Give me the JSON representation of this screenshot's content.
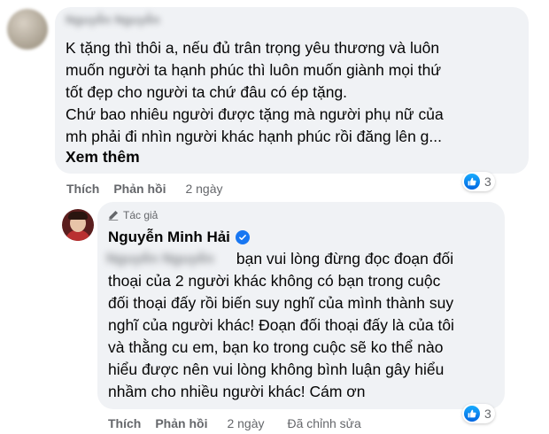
{
  "comment": {
    "author_blurred": "Nguyễn Nguyễn",
    "lines": [
      "K tặng thì thôi a, nếu đủ trân trọng yêu thương và luôn",
      "muốn người ta hạnh phúc thì luôn muốn giành mọi thứ",
      "tốt đẹp cho người ta chứ đâu có ép tặng.",
      "Chứ bao nhiêu người được tặng mà người phụ nữ của",
      "mh phải đi nhìn người khác hạnh phúc rồi đăng lên g..."
    ],
    "see_more": "Xem thêm",
    "actions": {
      "like": "Thích",
      "reply": "Phản hồi",
      "time": "2 ngày"
    },
    "reaction_count": "3"
  },
  "reply": {
    "badge": "Tác giả",
    "author": "Nguyễn Minh Hải",
    "mention_blurred": "Nguyễn Nguyễn",
    "first_line": " bạn vui lòng đừng đọc đoạn đối",
    "lines": [
      "thoại của 2 người khác không có bạn trong cuộc",
      "đối thoại đấy rồi biến suy nghĩ của mình thành suy",
      "nghĩ của người khác! Đoạn đối thoại đấy là của tôi",
      "và thằng cu em, bạn ko trong cuộc sẽ ko thể nào",
      "hiểu được nên vui lòng không bình luận gây hiểu",
      "nhầm cho nhiều người khác! Cám ơn"
    ],
    "actions": {
      "like": "Thích",
      "reply": "Phản hồi",
      "time": "2 ngày",
      "edited": "Đã chỉnh sửa"
    },
    "reaction_count": "3"
  },
  "icons": {
    "like": "like-icon",
    "pencil": "pencil-icon",
    "verified": "verified-badge-icon"
  },
  "colors": {
    "bubble": "#f0f2f5",
    "accent": "#1877f2",
    "meta": "#65676b"
  }
}
